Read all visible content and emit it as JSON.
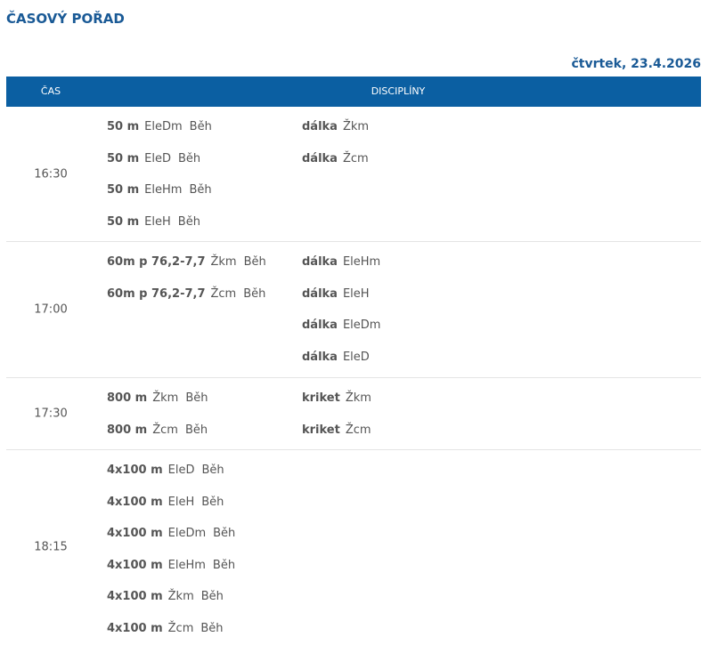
{
  "page": {
    "title": "ČASOVÝ POŘAD",
    "date": "čtvrtek, 23.4.2026"
  },
  "header": {
    "time_label": "ČAS",
    "disciplines_label": "DISCIPLÍNY"
  },
  "schedule": [
    {
      "time": "16:30",
      "height": 151,
      "left": [
        {
          "discipline": "50 m",
          "category": "EleDm",
          "type": "Běh"
        },
        {
          "discipline": "50 m",
          "category": "EleD",
          "type": "Běh"
        },
        {
          "discipline": "50 m",
          "category": "EleHm",
          "type": "Běh"
        },
        {
          "discipline": "50 m",
          "category": "EleH",
          "type": "Běh"
        }
      ],
      "right": [
        {
          "discipline": "dálka",
          "category": "Žkm",
          "type": ""
        },
        {
          "discipline": "dálka",
          "category": "Žcm",
          "type": ""
        }
      ]
    },
    {
      "time": "17:00",
      "height": 152,
      "left": [
        {
          "discipline": "60m p 76,2-7,7",
          "category": "Žkm",
          "type": "Běh"
        },
        {
          "discipline": "60m p 76,2-7,7",
          "category": "Žcm",
          "type": "Běh"
        }
      ],
      "right": [
        {
          "discipline": "dálka",
          "category": "EleHm",
          "type": ""
        },
        {
          "discipline": "dálka",
          "category": "EleH",
          "type": ""
        },
        {
          "discipline": "dálka",
          "category": "EleDm",
          "type": ""
        },
        {
          "discipline": "dálka",
          "category": "EleD",
          "type": ""
        }
      ]
    },
    {
      "time": "17:30",
      "height": 80,
      "left": [
        {
          "discipline": "800 m",
          "category": "Žkm",
          "type": "Běh"
        },
        {
          "discipline": "800 m",
          "category": "Žcm",
          "type": "Běh"
        }
      ],
      "right": [
        {
          "discipline": "kriket",
          "category": "Žkm",
          "type": ""
        },
        {
          "discipline": "kriket",
          "category": "Žcm",
          "type": ""
        }
      ]
    },
    {
      "time": "18:15",
      "height": 217,
      "left": [
        {
          "discipline": "4x100 m",
          "category": "EleD",
          "type": "Běh"
        },
        {
          "discipline": "4x100 m",
          "category": "EleH",
          "type": "Běh"
        },
        {
          "discipline": "4x100 m",
          "category": "EleDm",
          "type": "Běh"
        },
        {
          "discipline": "4x100 m",
          "category": "EleHm",
          "type": "Běh"
        },
        {
          "discipline": "4x100 m",
          "category": "Žkm",
          "type": "Běh"
        },
        {
          "discipline": "4x100 m",
          "category": "Žcm",
          "type": "Běh"
        }
      ],
      "right": []
    }
  ]
}
